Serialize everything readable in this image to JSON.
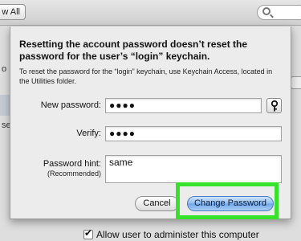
{
  "toolbar": {
    "show_all_label": "w All"
  },
  "background": {
    "fragment_left_1": "o",
    "fragment_left_2": "se",
    "checkbox_label": "Allow user to administer this computer"
  },
  "dialog": {
    "title": "Resetting the account password doesn’t reset the password for the user’s “login” keychain.",
    "subtitle": "To reset the password for the “login” keychain, use Keychain Access, located in the Utilities folder.",
    "new_password_label": "New password:",
    "new_password_value": "●●●●",
    "verify_label": "Verify:",
    "verify_value": "●●●●",
    "hint_label": "Password hint:",
    "hint_sub_label": "(Recommended)",
    "hint_value": "same",
    "cancel_label": "Cancel",
    "change_password_label": "Change Password",
    "key_icon": "key-icon"
  },
  "colors": {
    "highlight": "#37e22b",
    "primary_button": "#8fbcf0",
    "sheet_background": "#ececec"
  }
}
